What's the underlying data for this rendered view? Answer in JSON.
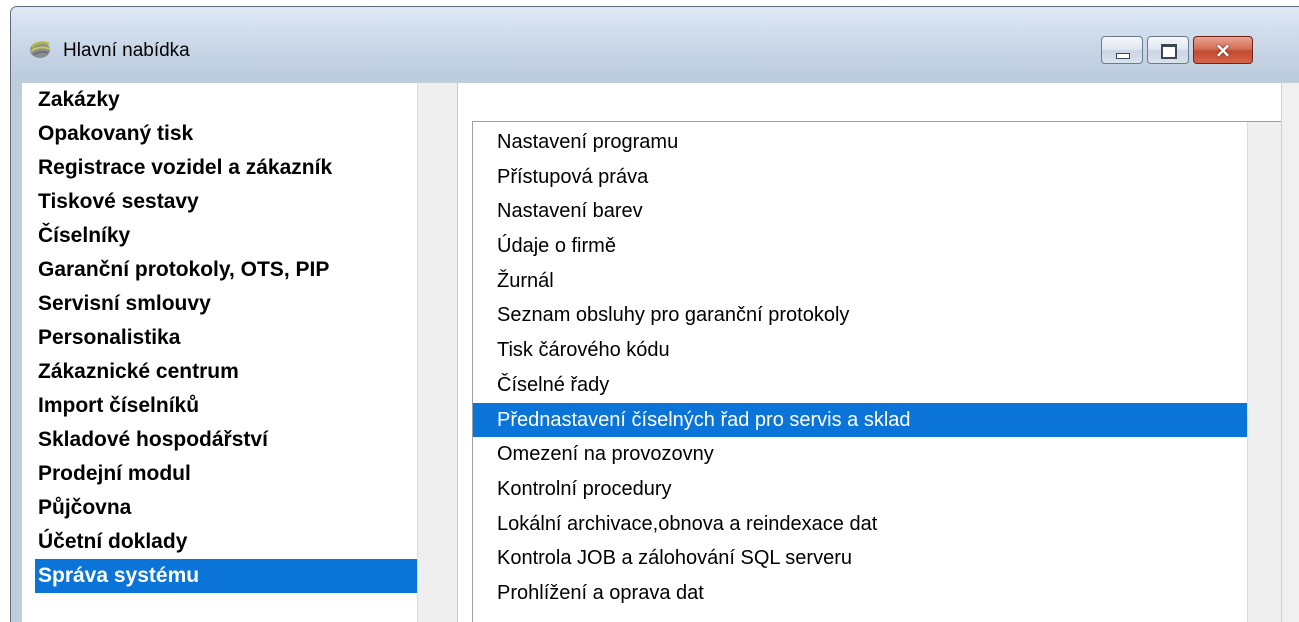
{
  "window": {
    "title": "Hlavní nabídka",
    "controls": {
      "minimize": "minimize",
      "maximize": "maximize",
      "close": "close"
    },
    "close_glyph": "×"
  },
  "colors": {
    "selection": "#0a74d8",
    "close_button": "#c24a2f",
    "titlebar": "#ccdaea"
  },
  "main_menu": {
    "items": [
      {
        "label": "Zakázky",
        "selected": false
      },
      {
        "label": "Opakovaný tisk",
        "selected": false
      },
      {
        "label": "Registrace vozidel a zákazník",
        "selected": false
      },
      {
        "label": "Tiskové sestavy",
        "selected": false
      },
      {
        "label": "Číselníky",
        "selected": false
      },
      {
        "label": "Garanční protokoly, OTS, PIP",
        "selected": false
      },
      {
        "label": "Servisní smlouvy",
        "selected": false
      },
      {
        "label": "Personalistika",
        "selected": false
      },
      {
        "label": "Zákaznické centrum",
        "selected": false
      },
      {
        "label": "Import číselníků",
        "selected": false
      },
      {
        "label": "Skladové hospodářství",
        "selected": false
      },
      {
        "label": "Prodejní modul",
        "selected": false
      },
      {
        "label": "Půjčovna",
        "selected": false
      },
      {
        "label": "Účetní doklady",
        "selected": false
      },
      {
        "label": "Správa systému",
        "selected": true
      }
    ]
  },
  "sub_menu": {
    "items": [
      {
        "label": "Nastavení programu",
        "selected": false
      },
      {
        "label": "Přístupová práva",
        "selected": false
      },
      {
        "label": "Nastavení barev",
        "selected": false
      },
      {
        "label": "Údaje o firmě",
        "selected": false
      },
      {
        "label": "Žurnál",
        "selected": false
      },
      {
        "label": "Seznam obsluhy pro garanční protokoly",
        "selected": false
      },
      {
        "label": "Tisk čárového kódu",
        "selected": false
      },
      {
        "label": "Číselné řady",
        "selected": false
      },
      {
        "label": "Přednastavení číselných řad pro servis a sklad",
        "selected": true
      },
      {
        "label": "Omezení na provozovny",
        "selected": false
      },
      {
        "label": "Kontrolní procedury",
        "selected": false
      },
      {
        "label": "Lokální archivace,obnova a reindexace dat",
        "selected": false
      },
      {
        "label": "Kontrola JOB a zálohování SQL serveru",
        "selected": false
      },
      {
        "label": "Prohlížení a oprava dat",
        "selected": false
      }
    ]
  }
}
